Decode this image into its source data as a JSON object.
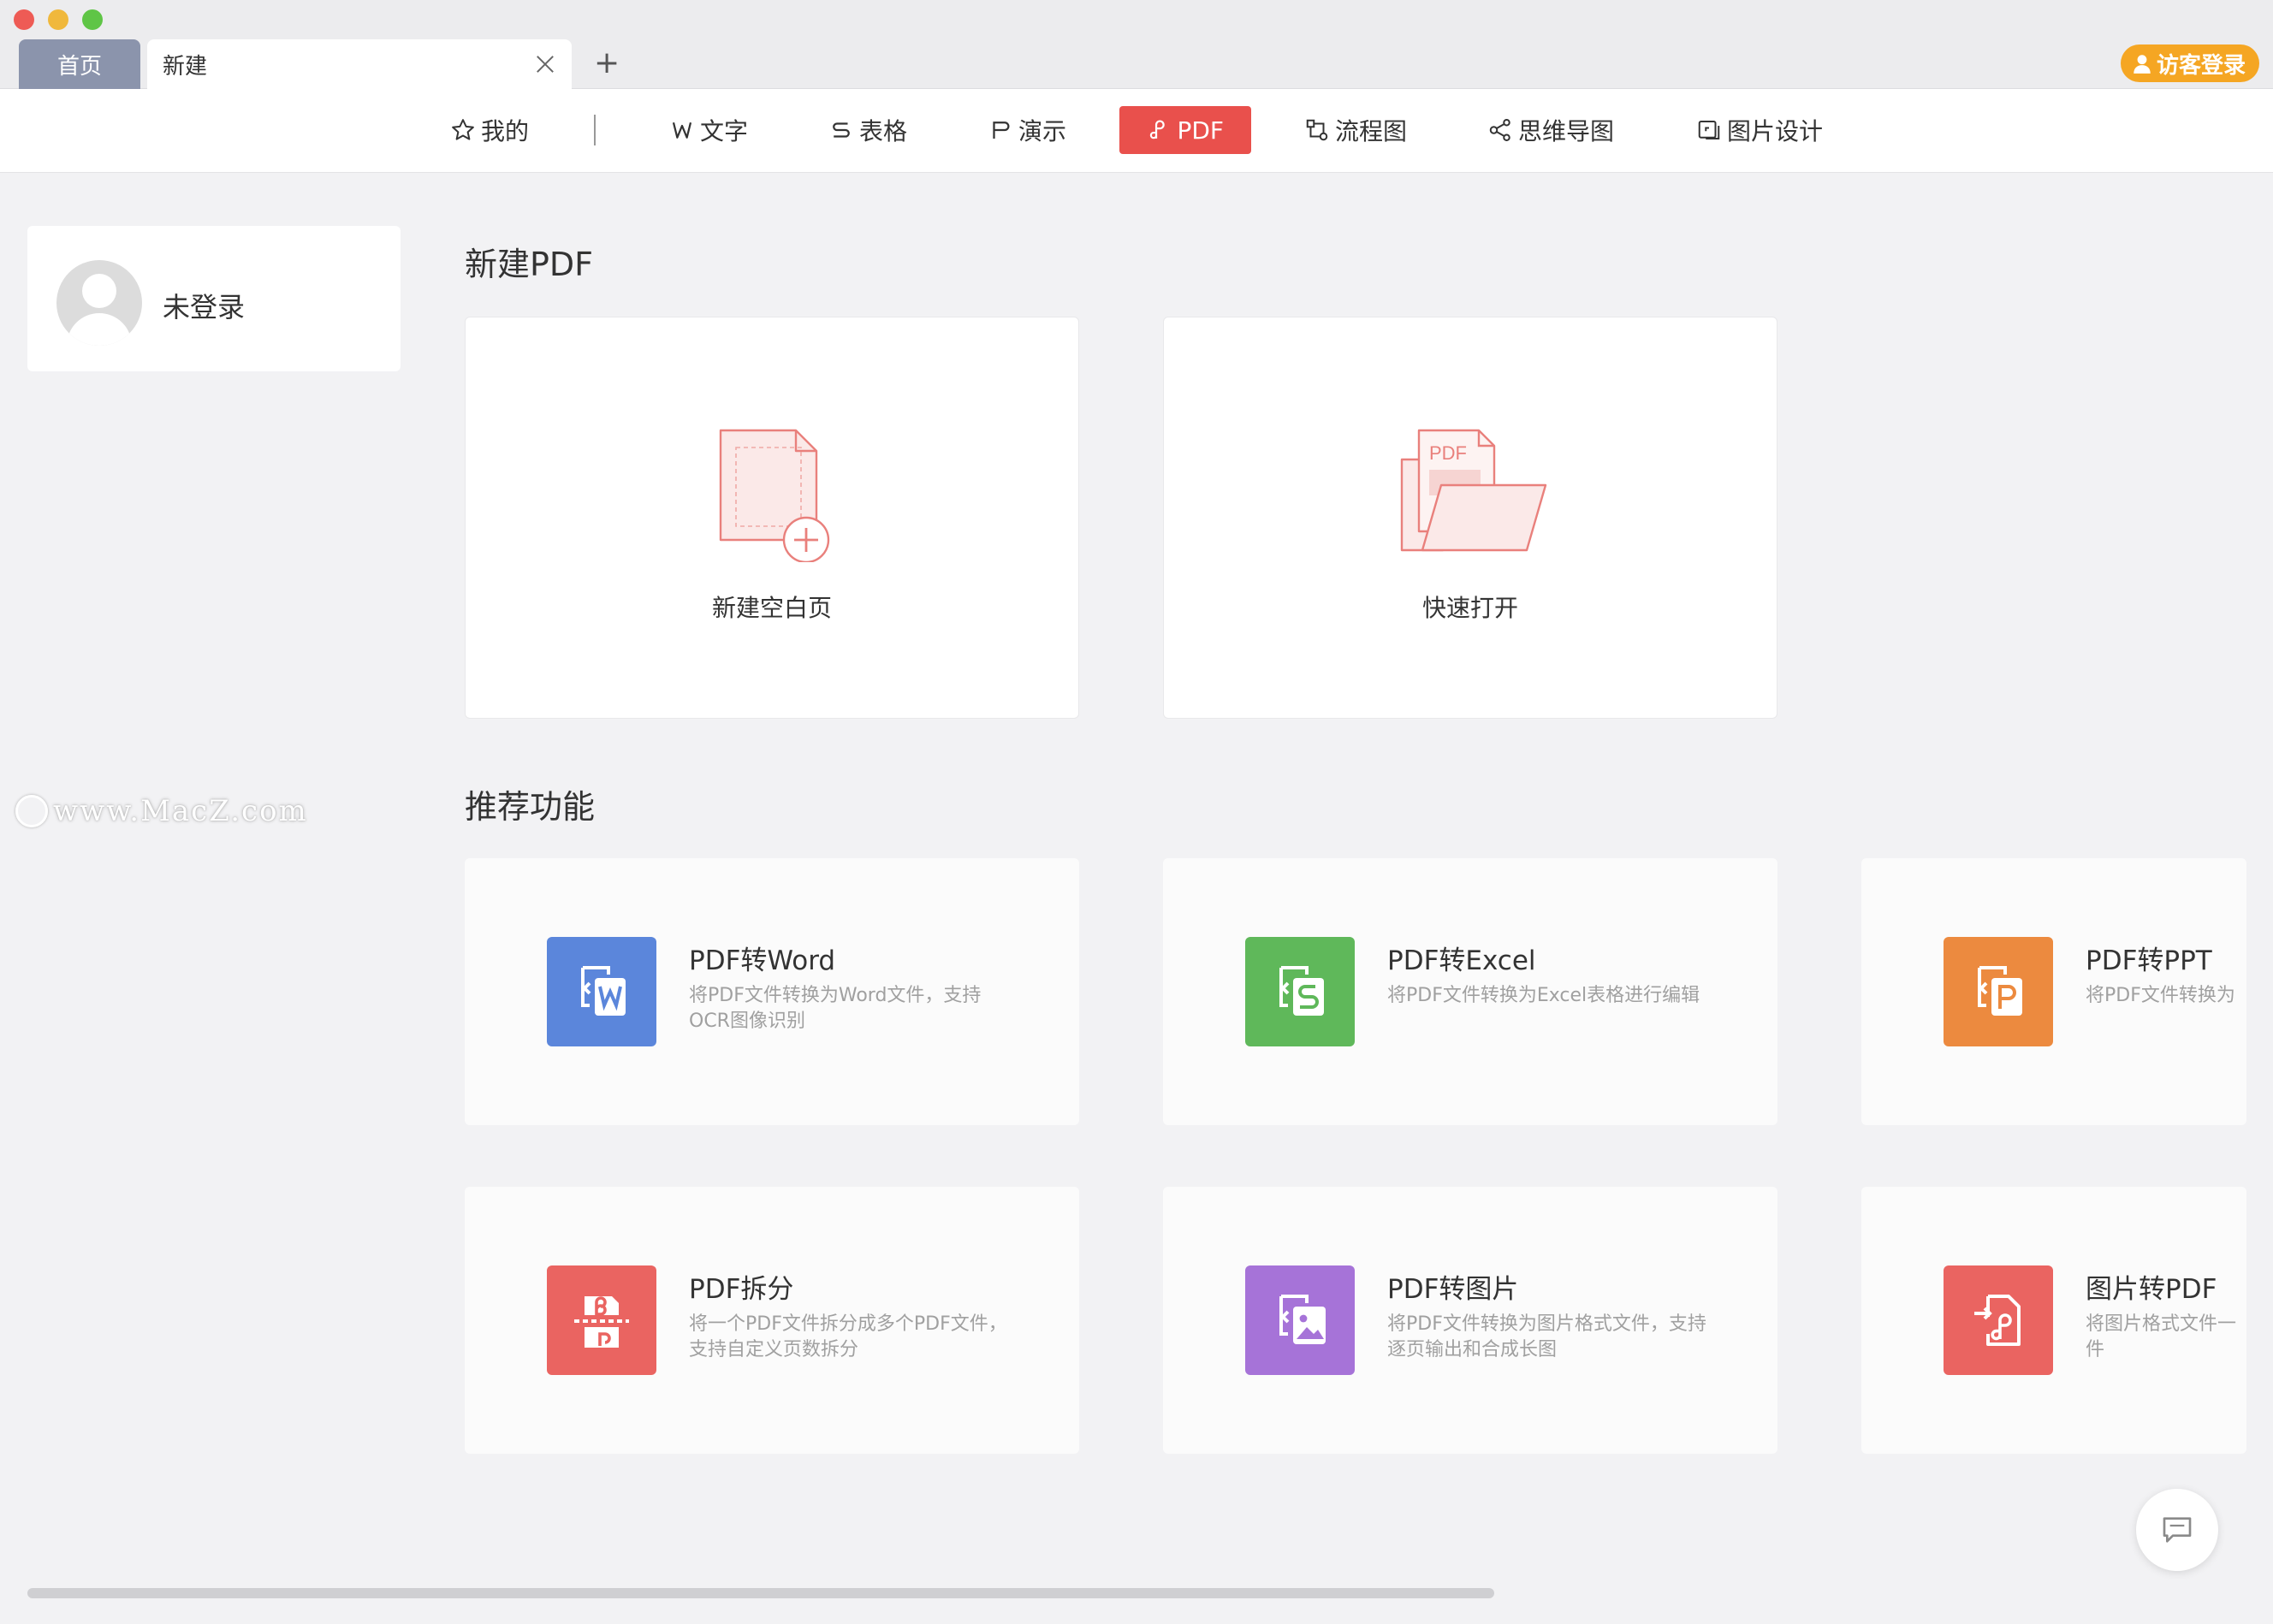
{
  "window": {
    "tabs": [
      {
        "label": "首页"
      },
      {
        "label": "新建"
      }
    ],
    "add_tab_glyph": "+",
    "guest_login_label": "访客登录"
  },
  "nav": {
    "items": [
      {
        "label": "我的",
        "icon": "star-icon"
      },
      {
        "label": "文字",
        "icon": "word-icon"
      },
      {
        "label": "表格",
        "icon": "sheet-icon"
      },
      {
        "label": "演示",
        "icon": "presentation-icon"
      },
      {
        "label": "PDF",
        "icon": "pdf-icon",
        "active": true
      },
      {
        "label": "流程图",
        "icon": "flowchart-icon"
      },
      {
        "label": "思维导图",
        "icon": "mindmap-icon"
      },
      {
        "label": "图片设计",
        "icon": "image-design-icon"
      }
    ]
  },
  "user": {
    "name": "未登录"
  },
  "watermark": "www.MacZ.com",
  "create_section": {
    "title": "新建PDF",
    "cards": [
      {
        "label": "新建空白页",
        "icon": "new-blank-page-icon"
      },
      {
        "label": "快速打开",
        "icon": "quick-open-folder-icon",
        "doc_text": "PDF"
      }
    ]
  },
  "recommend_section": {
    "title": "推荐功能",
    "features": [
      {
        "title": "PDF转Word",
        "desc": "将PDF文件转换为Word文件，支持OCR图像识别",
        "color": "#5b86db",
        "icon": "pdf-to-word-icon"
      },
      {
        "title": "PDF转Excel",
        "desc": "将PDF文件转换为Excel表格进行编辑",
        "color": "#5fb85a",
        "icon": "pdf-to-excel-icon"
      },
      {
        "title": "PDF转PPT",
        "desc": "将PDF文件转换为",
        "color": "#ec8a3f",
        "icon": "pdf-to-ppt-icon"
      },
      {
        "title": "PDF拆分",
        "desc": "将一个PDF文件拆分成多个PDF文件，支持自定义页数拆分",
        "color": "#ea6461",
        "icon": "pdf-split-icon"
      },
      {
        "title": "PDF转图片",
        "desc": "将PDF文件转换为图片格式文件，支持逐页输出和合成长图",
        "color": "#a673d8",
        "icon": "pdf-to-image-icon"
      },
      {
        "title": "图片转PDF",
        "desc": "将图片格式文件一件",
        "color": "#ea6461",
        "icon": "image-to-pdf-icon"
      }
    ]
  }
}
